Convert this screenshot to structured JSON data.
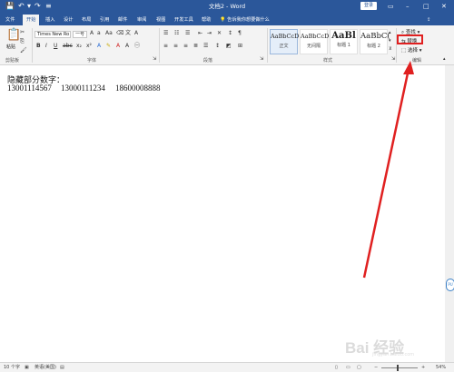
{
  "titlebar": {
    "save_icon": "save-icon",
    "undo_icon": "undo-icon",
    "redo_icon": "redo-icon",
    "customize_icon": "customize-quick-access-icon",
    "title": "文档2 - Word",
    "login_label": "登录",
    "ribbon_options_icon": "ribbon-display-options-icon",
    "minimize_icon": "minimize-icon",
    "maximize_icon": "maximize-icon",
    "close_icon": "close-icon"
  },
  "menu": {
    "tabs": [
      "文件",
      "开始",
      "插入",
      "设计",
      "布局",
      "引用",
      "邮件",
      "审阅",
      "视图",
      "开发工具",
      "帮助"
    ],
    "tell_me": "告诉我你想要做什么",
    "share_icon": "share-icon"
  },
  "ribbon": {
    "clipboard": {
      "paste_label": "粘贴",
      "group_label": "剪贴板"
    },
    "font": {
      "font_name": "Times New Ro",
      "font_size": "一号",
      "group_label": "字体"
    },
    "paragraph": {
      "group_label": "段落"
    },
    "styles": {
      "items": [
        {
          "sample": "AaBbCcD",
          "name": "正文"
        },
        {
          "sample": "AaBbCcD",
          "name": "无间隔"
        },
        {
          "sample": "AaBl",
          "name": "标题 1"
        },
        {
          "sample": "AaBbC(",
          "name": "标题 2"
        }
      ],
      "group_label": "样式"
    },
    "editing": {
      "find_label": "查找",
      "replace_label": "替换",
      "select_label": "选择",
      "group_label": "编辑"
    }
  },
  "document": {
    "line1": "隐藏部分数字：",
    "numbers": [
      "13001114567",
      "13000111234",
      "18600008888"
    ]
  },
  "status": {
    "word_count": "10 个字",
    "language": "英语(美国)",
    "zoom": "54%",
    "zoom_minus": "−",
    "zoom_plus": "+"
  },
  "annotation": {
    "highlight_color": "#e02020",
    "arrow_color": "#e02020"
  },
  "watermark": {
    "brand": "Bai 经验",
    "url": "jingyan.baidu.com"
  }
}
